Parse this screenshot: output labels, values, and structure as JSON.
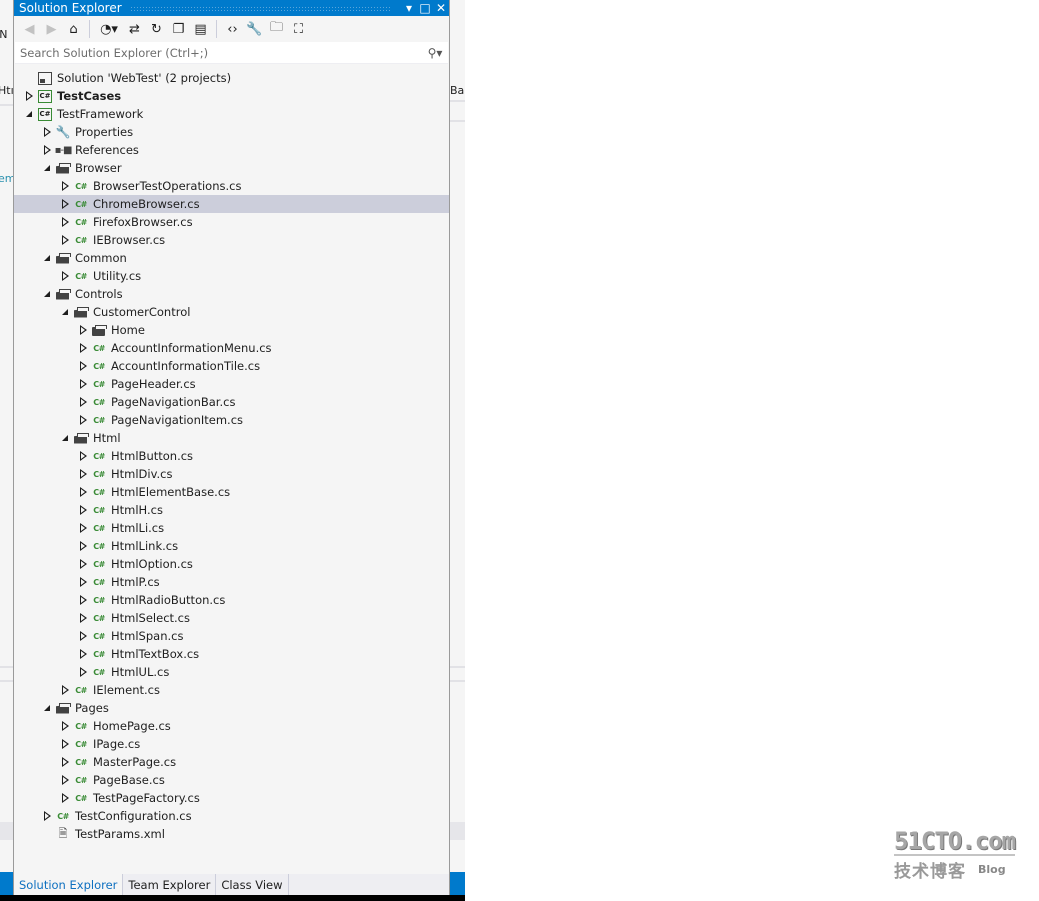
{
  "panel": {
    "title": "Solution Explorer",
    "title_buttons": {
      "dropdown": "▾",
      "maximize": "□",
      "close": "✕"
    },
    "toolbar": [
      {
        "name": "back-button",
        "icon": "back-icon",
        "glyph": "◀",
        "disabled": true
      },
      {
        "name": "forward-button",
        "icon": "forward-icon",
        "glyph": "▶",
        "disabled": true
      },
      {
        "name": "home-button",
        "icon": "home-icon",
        "glyph": "⌂",
        "disabled": false
      },
      {
        "name": "pending-changes-filter-button",
        "icon": "clock-filter-icon",
        "glyph": "◔▾",
        "disabled": false
      },
      {
        "name": "sync-with-active-document-button",
        "icon": "sync-arrows-icon",
        "glyph": "⇄",
        "disabled": false
      },
      {
        "name": "refresh-button",
        "icon": "refresh-icon",
        "glyph": "↻",
        "disabled": false
      },
      {
        "name": "collapse-all-button",
        "icon": "collapse-all-icon",
        "glyph": "❐",
        "disabled": false
      },
      {
        "name": "show-all-files-button",
        "icon": "show-all-files-icon",
        "glyph": "▤",
        "disabled": false
      },
      {
        "name": "view-code-button",
        "icon": "code-icon",
        "glyph": "‹›",
        "disabled": false
      },
      {
        "name": "properties-button",
        "icon": "wrench-icon",
        "glyph": "🔧",
        "disabled": false
      },
      {
        "name": "preview-selected-items-button",
        "icon": "folder-search-icon",
        "glyph": "🗀",
        "disabled": false
      },
      {
        "name": "view-class-diagram-button",
        "icon": "class-diagram-icon",
        "glyph": "⛶",
        "disabled": false
      }
    ],
    "search": {
      "placeholder": "Search Solution Explorer (Ctrl+;)",
      "value": ""
    },
    "tree": [
      {
        "label": "Solution 'WebTest' (2 projects)",
        "icon": "solution",
        "level": 0,
        "arrow": "none"
      },
      {
        "label": "TestCases",
        "icon": "csproj",
        "level": 0,
        "arrow": "collapsed",
        "bold": true
      },
      {
        "label": "TestFramework",
        "icon": "csproj",
        "level": 0,
        "arrow": "expanded"
      },
      {
        "label": "Properties",
        "icon": "wrench",
        "level": 1,
        "arrow": "collapsed"
      },
      {
        "label": "References",
        "icon": "references",
        "level": 1,
        "arrow": "collapsed"
      },
      {
        "label": "Browser",
        "icon": "folder-open",
        "level": 1,
        "arrow": "expanded"
      },
      {
        "label": "BrowserTestOperations.cs",
        "icon": "cs",
        "level": 2,
        "arrow": "collapsed"
      },
      {
        "label": "ChromeBrowser.cs",
        "icon": "cs",
        "level": 2,
        "arrow": "collapsed",
        "selected": true
      },
      {
        "label": "FirefoxBrowser.cs",
        "icon": "cs",
        "level": 2,
        "arrow": "collapsed"
      },
      {
        "label": "IEBrowser.cs",
        "icon": "cs",
        "level": 2,
        "arrow": "collapsed"
      },
      {
        "label": "Common",
        "icon": "folder-open",
        "level": 1,
        "arrow": "expanded"
      },
      {
        "label": "Utility.cs",
        "icon": "cs",
        "level": 2,
        "arrow": "collapsed"
      },
      {
        "label": "Controls",
        "icon": "folder-open",
        "level": 1,
        "arrow": "expanded"
      },
      {
        "label": "CustomerControl",
        "icon": "folder-open",
        "level": 2,
        "arrow": "expanded"
      },
      {
        "label": "Home",
        "icon": "folder",
        "level": 3,
        "arrow": "collapsed"
      },
      {
        "label": "AccountInformationMenu.cs",
        "icon": "cs",
        "level": 3,
        "arrow": "collapsed"
      },
      {
        "label": "AccountInformationTile.cs",
        "icon": "cs",
        "level": 3,
        "arrow": "collapsed"
      },
      {
        "label": "PageHeader.cs",
        "icon": "cs",
        "level": 3,
        "arrow": "collapsed"
      },
      {
        "label": "PageNavigationBar.cs",
        "icon": "cs",
        "level": 3,
        "arrow": "collapsed"
      },
      {
        "label": "PageNavigationItem.cs",
        "icon": "cs",
        "level": 3,
        "arrow": "collapsed"
      },
      {
        "label": "Html",
        "icon": "folder-open",
        "level": 2,
        "arrow": "expanded"
      },
      {
        "label": "HtmlButton.cs",
        "icon": "cs",
        "level": 3,
        "arrow": "collapsed"
      },
      {
        "label": "HtmlDiv.cs",
        "icon": "cs",
        "level": 3,
        "arrow": "collapsed"
      },
      {
        "label": "HtmlElementBase.cs",
        "icon": "cs",
        "level": 3,
        "arrow": "collapsed"
      },
      {
        "label": "HtmlH.cs",
        "icon": "cs",
        "level": 3,
        "arrow": "collapsed"
      },
      {
        "label": "HtmlLi.cs",
        "icon": "cs",
        "level": 3,
        "arrow": "collapsed"
      },
      {
        "label": "HtmlLink.cs",
        "icon": "cs",
        "level": 3,
        "arrow": "collapsed"
      },
      {
        "label": "HtmlOption.cs",
        "icon": "cs",
        "level": 3,
        "arrow": "collapsed"
      },
      {
        "label": "HtmlP.cs",
        "icon": "cs",
        "level": 3,
        "arrow": "collapsed"
      },
      {
        "label": "HtmlRadioButton.cs",
        "icon": "cs",
        "level": 3,
        "arrow": "collapsed"
      },
      {
        "label": "HtmlSelect.cs",
        "icon": "cs",
        "level": 3,
        "arrow": "collapsed"
      },
      {
        "label": "HtmlSpan.cs",
        "icon": "cs",
        "level": 3,
        "arrow": "collapsed"
      },
      {
        "label": "HtmlTextBox.cs",
        "icon": "cs",
        "level": 3,
        "arrow": "collapsed"
      },
      {
        "label": "HtmlUL.cs",
        "icon": "cs",
        "level": 3,
        "arrow": "collapsed"
      },
      {
        "label": "IElement.cs",
        "icon": "cs",
        "level": 2,
        "arrow": "collapsed"
      },
      {
        "label": "Pages",
        "icon": "folder-open",
        "level": 1,
        "arrow": "expanded"
      },
      {
        "label": "HomePage.cs",
        "icon": "cs",
        "level": 2,
        "arrow": "collapsed"
      },
      {
        "label": "IPage.cs",
        "icon": "cs",
        "level": 2,
        "arrow": "collapsed"
      },
      {
        "label": "MasterPage.cs",
        "icon": "cs",
        "level": 2,
        "arrow": "collapsed"
      },
      {
        "label": "PageBase.cs",
        "icon": "cs",
        "level": 2,
        "arrow": "collapsed"
      },
      {
        "label": "TestPageFactory.cs",
        "icon": "cs",
        "level": 2,
        "arrow": "collapsed"
      },
      {
        "label": "TestConfiguration.cs",
        "icon": "cs",
        "level": 1,
        "arrow": "collapsed"
      },
      {
        "label": "TestParams.xml",
        "icon": "xml",
        "level": 1,
        "arrow": "none"
      }
    ],
    "tabs": [
      {
        "label": "Solution Explorer",
        "active": true
      },
      {
        "label": "Team Explorer",
        "active": false
      },
      {
        "label": "Class View",
        "active": false
      }
    ]
  },
  "background_fragments": {
    "left_top": "IN",
    "left_tab": "Htı",
    "left_code": "em",
    "left_paren": ")",
    "right_tab": "Ba"
  },
  "watermark": {
    "site": "51CTO.com",
    "cn": "技术博客",
    "blog": "Blog"
  },
  "colors": {
    "accent": "#007acc",
    "panel_bg": "#f5f5f5",
    "selection": "#cccedb",
    "csharp_green": "#388a34",
    "active_tab_text": "#0e70c0"
  }
}
